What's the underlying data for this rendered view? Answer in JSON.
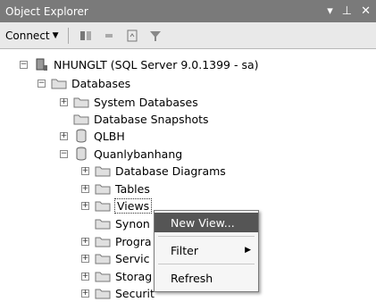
{
  "window": {
    "title": "Object Explorer",
    "controls": [
      "pin-icon",
      "auto-hide-icon",
      "close-icon"
    ]
  },
  "toolbar": {
    "connect_label": "Connect"
  },
  "tree": [
    {
      "label": "NHUNGLT (SQL Server 9.0.1399 - sa)",
      "icon": "server-icon",
      "expander": "minus"
    },
    {
      "label": "Databases",
      "icon": "folder-icon",
      "expander": "minus"
    },
    {
      "label": "System Databases",
      "icon": "folder-icon",
      "expander": "plus"
    },
    {
      "label": "Database Snapshots",
      "icon": "folder-icon",
      "expander": "none"
    },
    {
      "label": "QLBH",
      "icon": "database-icon",
      "expander": "plus"
    },
    {
      "label": "Quanlybanhang",
      "icon": "database-icon",
      "expander": "minus"
    },
    {
      "label": "Database Diagrams",
      "icon": "folder-icon",
      "expander": "plus"
    },
    {
      "label": "Tables",
      "icon": "folder-icon",
      "expander": "plus"
    },
    {
      "label": "Views",
      "icon": "folder-icon",
      "expander": "plus"
    },
    {
      "label": "Synon",
      "icon": "folder-icon",
      "expander": "none"
    },
    {
      "label": "Progra",
      "icon": "folder-icon",
      "expander": "plus"
    },
    {
      "label": "Servic",
      "icon": "folder-icon",
      "expander": "plus"
    },
    {
      "label": "Storag",
      "icon": "folder-icon",
      "expander": "plus"
    },
    {
      "label": "Securit",
      "icon": "folder-icon",
      "expander": "plus"
    }
  ],
  "context_menu": {
    "items": [
      {
        "label": "New View...",
        "highlighted": true
      },
      {
        "label": "Filter",
        "submenu": true
      },
      {
        "label": "Refresh"
      }
    ]
  }
}
